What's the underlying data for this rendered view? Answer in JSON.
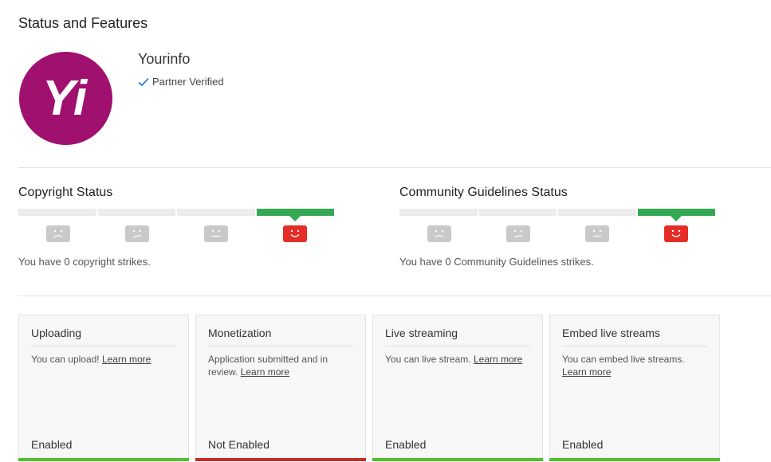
{
  "page": {
    "title": "Status and Features"
  },
  "channel": {
    "name": "Yourinfo",
    "logo_text": "Yi",
    "logo_color": "#a0106f",
    "verified_label": "Partner Verified",
    "verified_color": "#1a73c8"
  },
  "copyright": {
    "title": "Copyright Status",
    "strikes": 0,
    "message": "You have 0 copyright strikes."
  },
  "community": {
    "title": "Community Guidelines Status",
    "strikes": 0,
    "message": "You have 0 Community Guidelines strikes."
  },
  "colors": {
    "good": "#35a853",
    "enabled": "#4fc12a",
    "not_enabled": "#cc2a26",
    "face_active": "#e52d27",
    "face_inactive": "#c9c9c9"
  },
  "cards": [
    {
      "title": "Uploading",
      "desc": "You can upload!",
      "link": "Learn more",
      "state": "Enabled",
      "bar_color": "#4fc12a"
    },
    {
      "title": "Monetization",
      "desc": "Application submitted and in review.",
      "link": "Learn more",
      "state": "Not Enabled",
      "bar_color": "#cc2a26"
    },
    {
      "title": "Live streaming",
      "desc": "You can live stream.",
      "link": "Learn more",
      "state": "Enabled",
      "bar_color": "#4fc12a"
    },
    {
      "title": "Embed live streams",
      "desc": "You can embed live streams.",
      "link": "Learn more",
      "state": "Enabled",
      "bar_color": "#4fc12a"
    }
  ]
}
